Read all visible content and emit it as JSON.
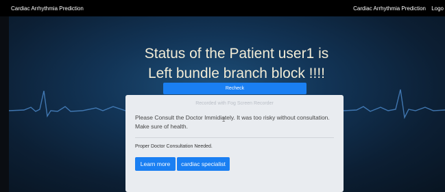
{
  "navbar": {
    "brand": "Cardiac Arrhythmia Prediction",
    "link_home": "Cardiac Arrhythmia Prediction",
    "link_logout": "Logo"
  },
  "hero": {
    "line1": "Status of the Patient user1 is",
    "line2": "Left bundle branch block !!!!",
    "recheck_label": "Recheck"
  },
  "card": {
    "watermark": "Recorded with Fog Screen Recorder",
    "message_line1": "Please Consult the Doctor Immidiately. It was too risky without consultation.",
    "message_line2": "Make sure of health.",
    "consult_note": "Proper Doctor Consultation Needed.",
    "learn_more_label": "Learn more",
    "specialist_label": "cardiac specialist"
  },
  "colors": {
    "accent": "#1a7ff2",
    "navbar_bg": "#000000",
    "headline": "#f2ecd6",
    "ecg_line": "#4a86c5"
  },
  "icons": {
    "cursor": "text-cursor-icon"
  }
}
